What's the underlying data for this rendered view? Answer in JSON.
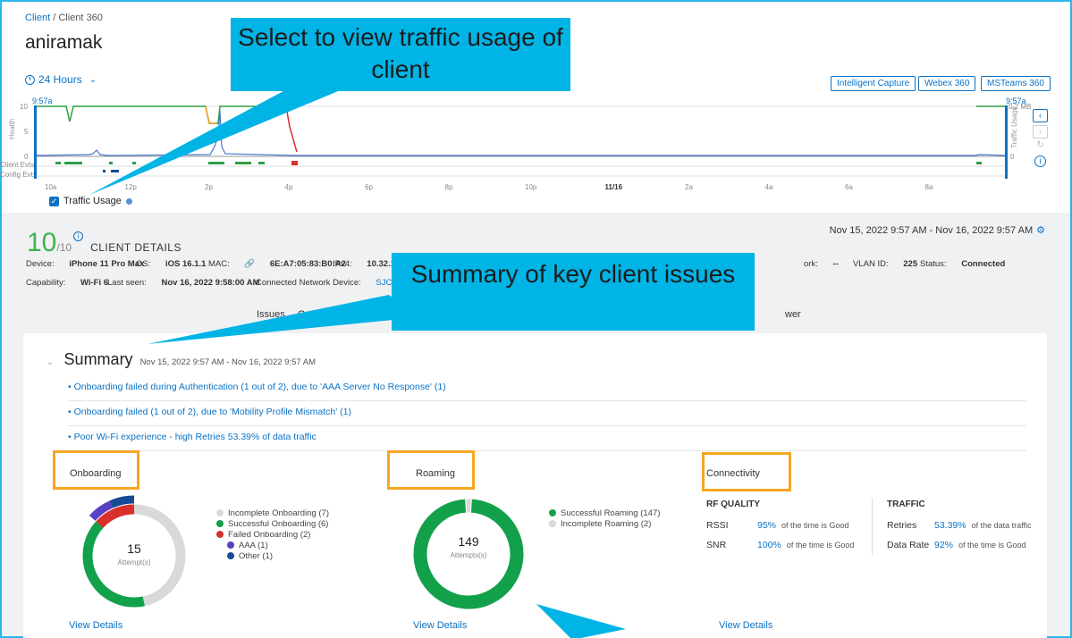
{
  "breadcrumb": {
    "root": "Client",
    "sep": "/",
    "current": "Client 360"
  },
  "page_title": "aniramak",
  "time_selector": {
    "label": "24 Hours"
  },
  "top_buttons": {
    "capture": "Intelligent Capture",
    "webex": "Webex 360",
    "msteams": "MSTeams 360"
  },
  "timeline": {
    "start_time_left": "9:57a",
    "start_time_right": "9:57a",
    "y_health_ticks": [
      "10",
      "5",
      "0"
    ],
    "y_health_label": "Health",
    "y_traffic_label": "Traffic Usage",
    "y_traffic_ticks": [
      "0.2 MB",
      "0"
    ],
    "row_labels": [
      "Client Evts",
      "Config Evts"
    ],
    "x_ticks": [
      "10a",
      "12p",
      "2p",
      "4p",
      "6p",
      "8p",
      "10p",
      "11/16",
      "2a",
      "4a",
      "6a",
      "8a"
    ],
    "traffic_usage_label": "Traffic Usage",
    "colors": {
      "health_good": "#2e9e46",
      "health_warn": "#f2a31b",
      "health_bad": "#d9302c",
      "traffic": "#4a74d1"
    }
  },
  "client_score": {
    "value": "10",
    "denominator": "/10",
    "label": "CLIENT DETAILS"
  },
  "date_range": "Nov 15, 2022 9:57 AM - Nov 16, 2022 9:57 AM",
  "details_row1": {
    "device_label": "Device:",
    "device": "iPhone 11 Pro Max",
    "os_label": "OS:",
    "os": "iOS 16.1.1",
    "mac_label": "MAC:",
    "mac": "6E:A7:05:83:B0:A2",
    "ipv4_label": "IPv4:",
    "ipv4": "10.32.173",
    "network_label": "ork:",
    "network": "--",
    "vlan_label": "VLAN ID:",
    "vlan": "225",
    "status_label": "Status:",
    "status": "Connected"
  },
  "details_row2": {
    "cap_label": "Capability:",
    "cap": "Wi-Fi 6",
    "seen_label": "Last seen:",
    "seen": "Nov 16, 2022 9:58:00 AM",
    "cnd_label": "Connected Network Device:",
    "cnd": "SJC24-2"
  },
  "tabs": {
    "issues": "Issues",
    "partial1": "O",
    "partial2": "Sn",
    "power": "wer"
  },
  "summary": {
    "title": "Summary",
    "date": "Nov 15, 2022 9:57 AM - Nov 16, 2022 9:57 AM",
    "issues": [
      "• Onboarding failed during Authentication (1 out of 2), due to 'AAA Server No Response' (1)",
      "• Onboarding failed (1 out of 2), due to 'Mobility Profile Mismatch' (1)",
      "• Poor Wi-Fi experience - high Retries 53.39% of data traffic"
    ]
  },
  "onboarding": {
    "title": "Onboarding",
    "total": "15",
    "total_label": "Attempt(s)",
    "legend": [
      {
        "label": "Incomplete Onboarding (7)",
        "color": "#d9d9d9"
      },
      {
        "label": "Successful Onboarding (6)",
        "color": "#12a14a"
      },
      {
        "label": "Failed Onboarding (2)",
        "color": "#d9302c"
      },
      {
        "label": "AAA (1)",
        "color": "#5b3fc4"
      },
      {
        "label": "Other (1)",
        "color": "#144a96"
      }
    ],
    "values": {
      "incomplete": 7,
      "successful": 6,
      "failed": 2,
      "aaa": 1,
      "other": 1
    },
    "view": "View Details"
  },
  "roaming": {
    "title": "Roaming",
    "total": "149",
    "total_label": "Attempts(s)",
    "legend": [
      {
        "label": "Successful Roaming (147)",
        "color": "#12a14a"
      },
      {
        "label": "Incomplete Roaming (2)",
        "color": "#d9d9d9"
      }
    ],
    "values": {
      "successful": 147,
      "incomplete": 2
    },
    "view": "View Details"
  },
  "connectivity": {
    "title": "Connectivity",
    "rf_title": "RF QUALITY",
    "rssi_label": "RSSI",
    "rssi_value": "95%",
    "rssi_suffix": "of the time is Good",
    "snr_label": "SNR",
    "snr_value": "100%",
    "snr_suffix": "of the time is Good",
    "traffic_title": "TRAFFIC",
    "retries_label": "Retries",
    "retries_value": "53.39%",
    "retries_suffix": "of the data traffic",
    "rate_label": "Data Rate",
    "rate_value": "92%",
    "rate_suffix": "of the time is Good",
    "view": "View Details"
  },
  "callouts": {
    "traffic": "Select to view traffic usage of client",
    "summary": "Summary of key client issues"
  }
}
